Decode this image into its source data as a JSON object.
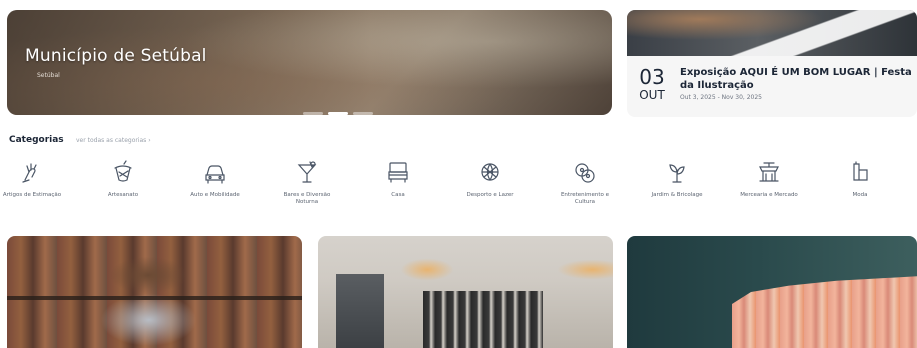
{
  "hero": {
    "title": "Município de Setúbal",
    "subtitle": "Setúbal"
  },
  "event": {
    "day": "03",
    "month": "OUT",
    "title": "Exposição AQUI É UM BOM LUGAR | Festa da Ilustração",
    "dates": "Out 3, 2025 - Nov 30, 2025"
  },
  "categories": {
    "heading": "Categorias",
    "see_all": "ver todas as categorias ›",
    "items": [
      {
        "label": "Artigos de Estimação",
        "icon": "pet-hand-icon"
      },
      {
        "label": "Artesanato",
        "icon": "crafts-icon"
      },
      {
        "label": "Auto e Mobilidade",
        "icon": "car-icon"
      },
      {
        "label": "Bares e Diversão Noturna",
        "icon": "cocktail-icon"
      },
      {
        "label": "Casa",
        "icon": "sofa-icon"
      },
      {
        "label": "Desporto e Lazer",
        "icon": "ball-icon"
      },
      {
        "label": "Entretenimento e Cultura",
        "icon": "film-icon"
      },
      {
        "label": "Jardim & Bricolage",
        "icon": "plant-icon"
      },
      {
        "label": "Mercearia e Mercado",
        "icon": "market-icon"
      },
      {
        "label": "Moda",
        "icon": "fashion-icon"
      }
    ]
  }
}
